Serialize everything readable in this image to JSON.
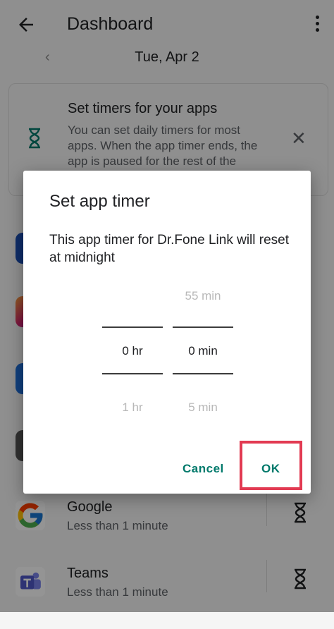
{
  "header": {
    "title": "Dashboard",
    "back_icon": "arrow-left-icon",
    "menu_icon": "more-vert-icon"
  },
  "date_nav": {
    "prev_icon": "chevron-left-icon",
    "date": "Tue, Apr 2"
  },
  "info_card": {
    "title": "Set timers for your apps",
    "body": "You can set daily timers for most apps. When the app timer ends, the app is paused for the rest of the day.",
    "icon": "hourglass-icon",
    "close_icon": "close-icon"
  },
  "apps": [
    {
      "name": "Google",
      "usage": "Less than 1 minute"
    },
    {
      "name": "Teams",
      "usage": "Less than 1 minute"
    }
  ],
  "dialog": {
    "title": "Set app timer",
    "message": "This app timer for Dr.Fone Link will reset at midnight",
    "hours": {
      "above": "",
      "selected": "0 hr",
      "below": "1 hr"
    },
    "minutes": {
      "above": "55 min",
      "selected": "0 min",
      "below": "5 min"
    },
    "cancel_label": "Cancel",
    "ok_label": "OK"
  },
  "colors": {
    "accent": "#00796b",
    "highlight": "#e23a52",
    "scrim": "rgba(0,0,0,0.42)"
  }
}
